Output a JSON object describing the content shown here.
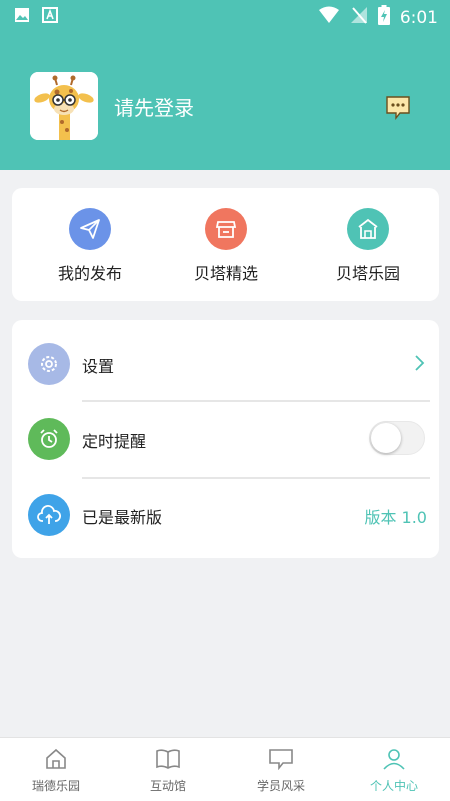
{
  "status_bar": {
    "time": "6:01"
  },
  "header": {
    "login_text": "请先登录"
  },
  "quick_actions": [
    {
      "label": "我的发布",
      "icon": "paper-plane-icon",
      "color": "#6b93e8"
    },
    {
      "label": "贝塔精选",
      "icon": "shop-icon",
      "color": "#f0765f"
    },
    {
      "label": "贝塔乐园",
      "icon": "building-icon",
      "color": "#4fc3b5"
    }
  ],
  "settings": {
    "settings_label": "设置",
    "reminder_label": "定时提醒",
    "reminder_enabled": false,
    "update_label": "已是最新版",
    "version_text": "版本 1.0"
  },
  "bottom_nav": [
    {
      "label": "瑞德乐园",
      "icon": "home-icon",
      "active": false
    },
    {
      "label": "互动馆",
      "icon": "book-icon",
      "active": false
    },
    {
      "label": "学员风采",
      "icon": "chat-icon",
      "active": false
    },
    {
      "label": "个人中心",
      "icon": "person-icon",
      "active": true
    }
  ],
  "colors": {
    "accent": "#4fc3b5",
    "background": "#f0f1f3"
  }
}
